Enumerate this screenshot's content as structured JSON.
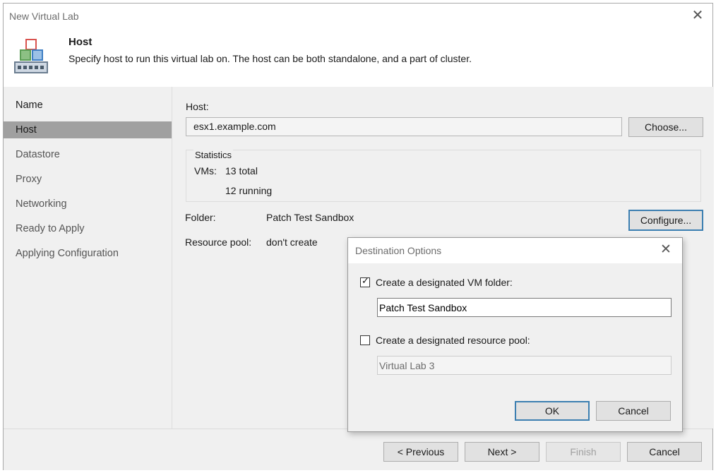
{
  "window": {
    "title": "New Virtual Lab"
  },
  "header": {
    "title": "Host",
    "description": "Specify host to run this virtual lab on. The host can be both standalone, and a part of cluster."
  },
  "sidebar": {
    "items": [
      {
        "label": "Name"
      },
      {
        "label": "Host"
      },
      {
        "label": "Datastore"
      },
      {
        "label": "Proxy"
      },
      {
        "label": "Networking"
      },
      {
        "label": "Ready to Apply"
      },
      {
        "label": "Applying Configuration"
      }
    ]
  },
  "main": {
    "host_label": "Host:",
    "host_value": "esx1.example.com",
    "choose_button": "Choose...",
    "statistics": {
      "title": "Statistics",
      "vms_label": "VMs:",
      "total": "13 total",
      "running": "12 running"
    },
    "folder_label": "Folder:",
    "folder_value": "Patch Test Sandbox",
    "configure_button": "Configure...",
    "pool_label": "Resource pool:",
    "pool_value": "don't create"
  },
  "footer": {
    "previous": "< Previous",
    "next": "Next >",
    "finish": "Finish",
    "cancel": "Cancel"
  },
  "dialog": {
    "title": "Destination Options",
    "folder_checkbox_label": "Create a designated VM folder:",
    "folder_checked": true,
    "folder_name": "Patch Test Sandbox",
    "pool_checkbox_label": "Create a designated resource pool:",
    "pool_checked": false,
    "pool_name": "Virtual Lab 3",
    "ok": "OK",
    "cancel": "Cancel"
  },
  "colors": {
    "accent": "#3c7fb1",
    "selected_nav": "#a0a0a0"
  }
}
